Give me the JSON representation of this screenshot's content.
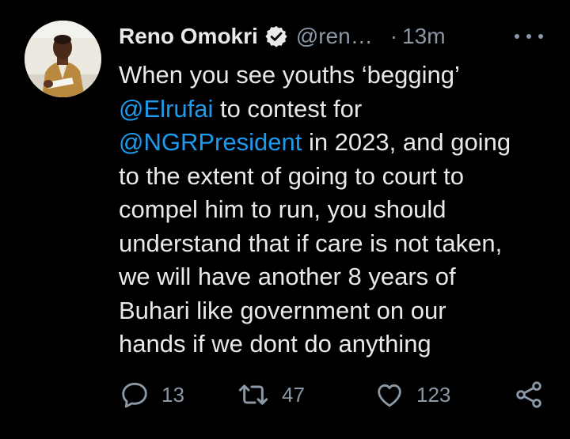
{
  "tweet": {
    "author_name": "Reno Omokri",
    "handle": "@ren…",
    "separator": "·",
    "time": "13m",
    "lines": [
      [
        {
          "text": "When you see youths ‘begging’",
          "mention": false
        }
      ],
      [
        {
          "text": "@Elrufai",
          "mention": true
        },
        {
          "text": " to contest for",
          "mention": false
        }
      ],
      [
        {
          "text": "@NGRPresident",
          "mention": true
        },
        {
          "text": " in 2023, and going",
          "mention": false
        }
      ],
      [
        {
          "text": "to the extent of going to court to",
          "mention": false
        }
      ],
      [
        {
          "text": "compel him to run, you should",
          "mention": false
        }
      ],
      [
        {
          "text": "understand that if care is not taken,",
          "mention": false
        }
      ],
      [
        {
          "text": "we will have another 8 years of",
          "mention": false
        }
      ],
      [
        {
          "text": "Buhari like government on our",
          "mention": false
        }
      ],
      [
        {
          "text": "hands if we dont do anything",
          "mention": false
        }
      ]
    ]
  },
  "actions": {
    "reply_count": "13",
    "retweet_count": "47",
    "like_count": "123"
  },
  "icons": {
    "verified": "verified-badge-icon",
    "more": "more-options-icon",
    "reply": "reply-icon",
    "retweet": "retweet-icon",
    "like": "heart-icon",
    "share": "share-icon"
  },
  "colors": {
    "background": "#000000",
    "text": "#e7e9ea",
    "secondary": "#8b98a5",
    "mention": "#1d9bf0"
  }
}
